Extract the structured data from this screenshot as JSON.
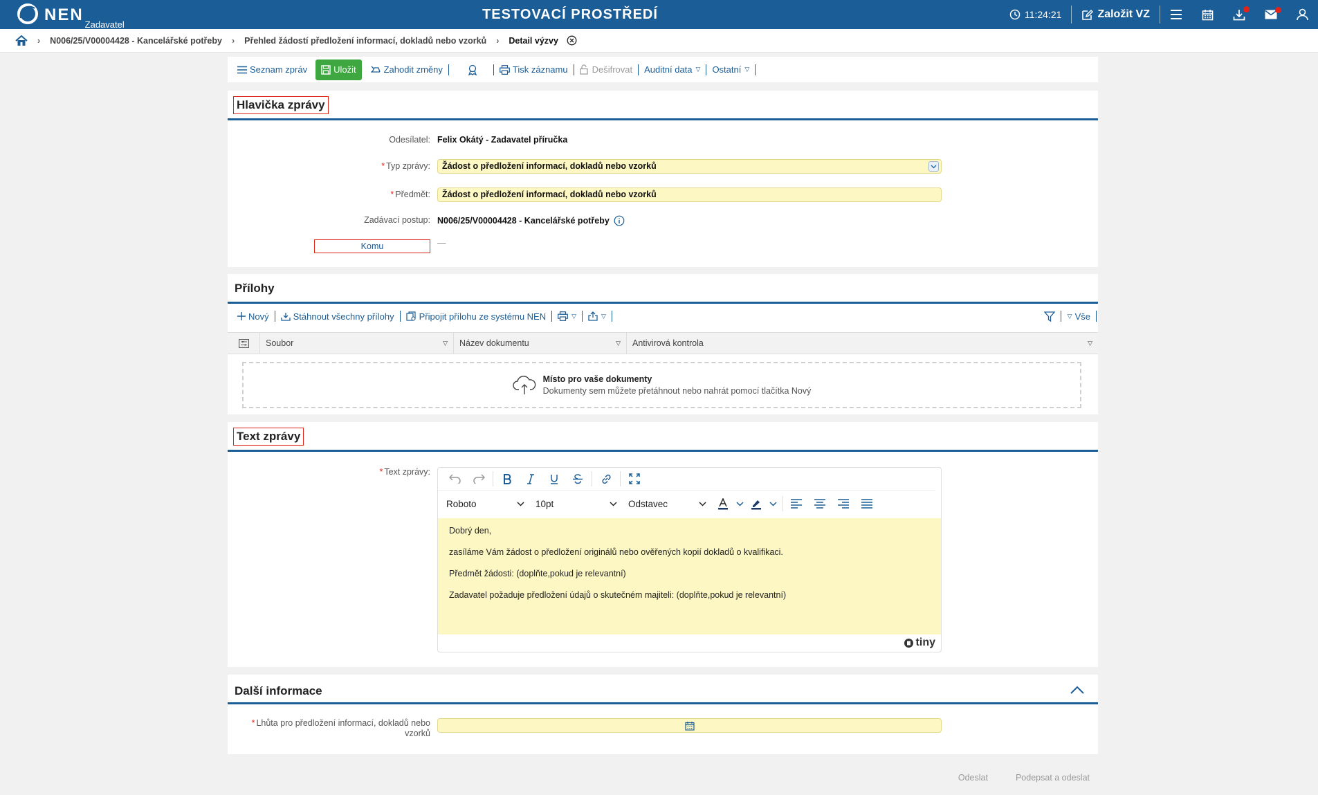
{
  "topbar": {
    "brand": "NEN",
    "role": "Zadavatel",
    "environment": "TESTOVACÍ PROSTŘEDÍ",
    "time": "11:24:21",
    "create_label": "Založit VZ",
    "accent": "#1a5d97"
  },
  "breadcrumb": {
    "items": [
      "N006/25/V00004428 - Kancelářské potřeby",
      "Přehled žádostí předložení informací, dokladů nebo vzorků",
      "Detail výzvy"
    ]
  },
  "toolbar": {
    "list_label": "Seznam zpráv",
    "save_label": "Uložit",
    "discard_label": "Zahodit změny",
    "print_label": "Tisk záznamu",
    "decrypt_label": "Dešifrovat",
    "audit_label": "Auditní data",
    "other_label": "Ostatní"
  },
  "header_section": {
    "title": "Hlavička zprávy",
    "sender_label": "Odesílatel:",
    "sender_value": "Felix Okátý - Zadavatel příručka",
    "type_label": "Typ zprávy:",
    "type_value": "Žádost o předložení informací, dokladů nebo vzorků",
    "subject_label": "Předmět:",
    "subject_value": "Žádost o předložení informací, dokladů nebo vzorků",
    "procedure_label": "Zadávací postup:",
    "procedure_value": "N006/25/V00004428 - Kancelářské potřeby",
    "to_label": "Komu",
    "to_value": "—"
  },
  "attachments": {
    "title": "Přílohy",
    "new_label": "Nový",
    "download_all_label": "Stáhnout všechny přílohy",
    "attach_nen_label": "Připojit přílohu ze systému NEN",
    "filter_all_label": "Vše",
    "columns": [
      "Soubor",
      "Název dokumentu",
      "Antivirová kontrola"
    ],
    "dropzone_title": "Místo pro vaše dokumenty",
    "dropzone_sub": "Dokumenty sem můžete přetáhnout nebo nahrát pomocí tlačítka Nový"
  },
  "text_section": {
    "title": "Text zprávy",
    "label": "Text zprávy:",
    "font": "Roboto",
    "size": "10pt",
    "block": "Odstavec",
    "paragraphs": [
      "Dobrý den,",
      "zasíláme Vám žádost o předložení originálů nebo ověřených kopií dokladů o kvalifikaci.",
      "Předmět žádosti: (doplňte,pokud je relevantní)",
      "Zadavatel požaduje předložení údajů o skutečném majiteli: (doplňte,pokud je relevantní)"
    ],
    "editor_brand": "tiny"
  },
  "more_info": {
    "title": "Další informace",
    "deadline_label_1": "Lhůta pro předložení informací, dokladů nebo",
    "deadline_label_2": "vzorků",
    "deadline_value": ""
  },
  "footer": {
    "send_label": "Odeslat",
    "sign_send_label": "Podepsat a odeslat"
  }
}
